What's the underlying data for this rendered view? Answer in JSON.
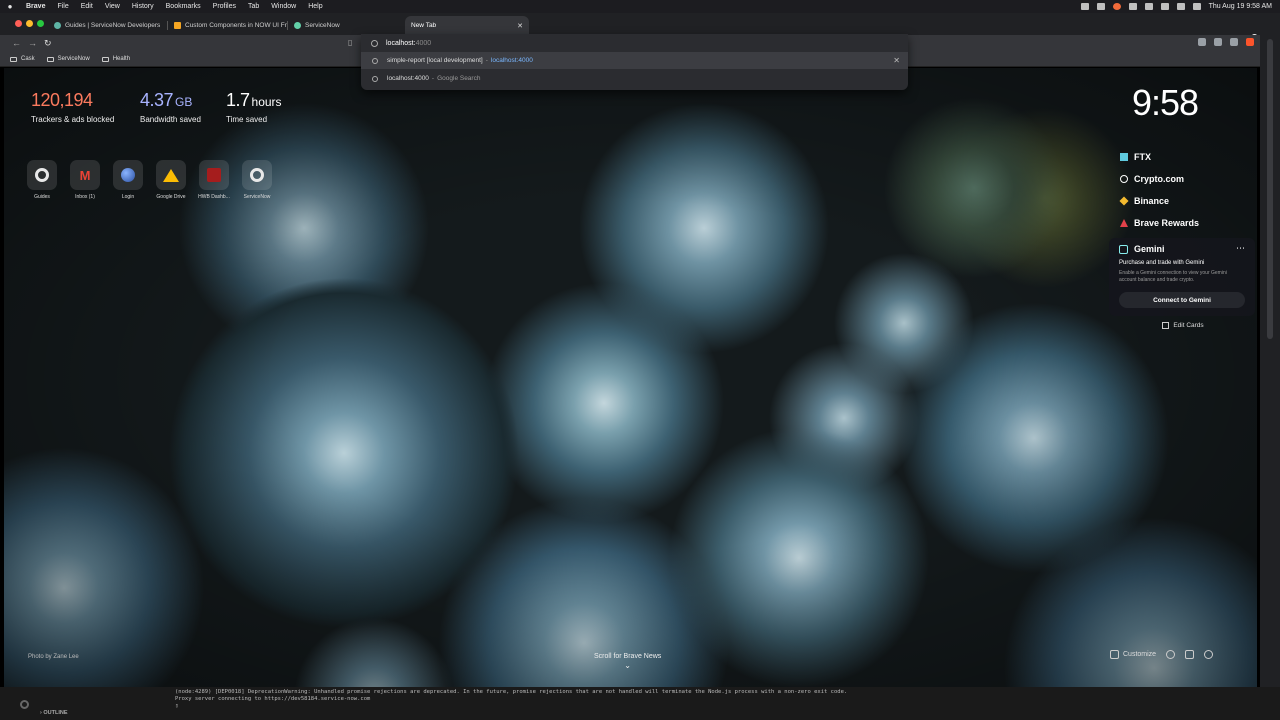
{
  "menubar": {
    "app": "Brave",
    "items": [
      "File",
      "Edit",
      "View",
      "History",
      "Bookmarks",
      "Profiles",
      "Tab",
      "Window",
      "Help"
    ],
    "datetime": "Thu Aug 19  9:58 AM"
  },
  "tabs": [
    {
      "title": "Guides | ServiceNow Developers",
      "fav": "#5eb5a6"
    },
    {
      "title": "Custom Components in NOW UI Fr",
      "fav": "#f5a623"
    },
    {
      "title": "ServiceNow",
      "fav": "#62d0a8"
    },
    {
      "title": "New Tab",
      "fav": ""
    }
  ],
  "omnibox": {
    "typed": "localhost:",
    "completion": "4000",
    "suggestions": [
      {
        "title": "simple-report [local development]",
        "url": "localhost:4000"
      },
      {
        "query": "localhost:4000",
        "source": "Google Search"
      }
    ]
  },
  "bookmarks": [
    "Cask",
    "ServiceNow",
    "Health"
  ],
  "stats": {
    "trackers": {
      "value": "120,194",
      "caption": "Trackers & ads blocked"
    },
    "bandwidth": {
      "value": "4.37",
      "unit": "GB",
      "caption": "Bandwidth saved"
    },
    "time": {
      "value": "1.7",
      "unit": "hours",
      "caption": "Time saved"
    }
  },
  "topsites": [
    {
      "label": "Guides"
    },
    {
      "label": "Inbox (1)"
    },
    {
      "label": "Login"
    },
    {
      "label": "Google Drive"
    },
    {
      "label": "HWB Dashb..."
    },
    {
      "label": "ServiceNow"
    }
  ],
  "clock": "9:58",
  "cards": {
    "tabs": [
      "FTX",
      "Crypto.com",
      "Binance",
      "Brave Rewards"
    ],
    "gemini": {
      "title": "Gemini",
      "subtitle": "Purchase and trade with Gemini",
      "description": "Enable a Gemini connection to view your Gemini account balance and trade crypto.",
      "button": "Connect to Gemini"
    },
    "edit_label": "Edit Cards"
  },
  "photo_credit": "Photo by Zane Lee",
  "scroll_news": "Scroll for Brave News",
  "customize_label": "Customize",
  "terminal": {
    "lines": [
      "(node:4289) [DEP0018] DeprecationWarning: Unhandled promise rejections are deprecated. In the future, promise rejections that are not handled will terminate the Node.js process with a non-zero exit code.",
      "Proxy server connecting to https://dev58184.service-now.com",
      "▯"
    ],
    "outline_label": "OUTLINE"
  }
}
